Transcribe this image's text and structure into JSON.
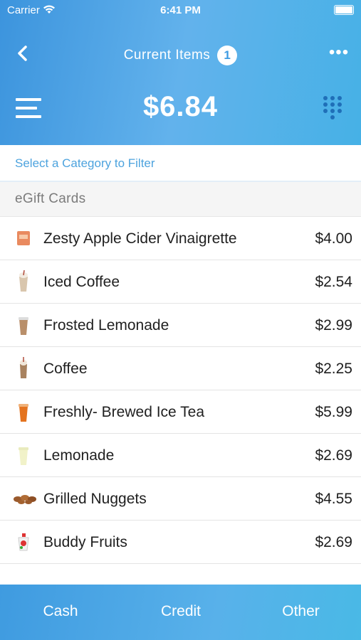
{
  "status_bar": {
    "carrier": "Carrier",
    "time": "6:41 PM"
  },
  "header": {
    "title": "Current Items",
    "item_count": "1",
    "more_label": "•••",
    "total": "$6.84"
  },
  "filter": {
    "label": "Select a Category to Filter"
  },
  "category": {
    "name": "eGift Cards"
  },
  "items": [
    {
      "name": "Zesty Apple Cider Vinaigrette",
      "price": "$4.00",
      "icon": "dressing-packet-icon"
    },
    {
      "name": "Iced Coffee",
      "price": "$2.54",
      "icon": "iced-coffee-icon"
    },
    {
      "name": "Frosted Lemonade",
      "price": "$2.99",
      "icon": "frosted-drink-icon"
    },
    {
      "name": "Coffee",
      "price": "$2.25",
      "icon": "coffee-cup-icon"
    },
    {
      "name": "Freshly- Brewed Ice Tea",
      "price": "$5.99",
      "icon": "ice-tea-icon"
    },
    {
      "name": "Lemonade",
      "price": "$2.69",
      "icon": "lemonade-icon"
    },
    {
      "name": "Grilled Nuggets",
      "price": "$4.55",
      "icon": "nuggets-icon"
    },
    {
      "name": "Buddy Fruits",
      "price": "$2.69",
      "icon": "fruit-pouch-icon"
    }
  ],
  "tabs": {
    "cash": "Cash",
    "credit": "Credit",
    "other": "Other"
  },
  "colors": {
    "accent": "#4da3de",
    "header_start": "#3c94dd",
    "header_end": "#46b1e6"
  }
}
